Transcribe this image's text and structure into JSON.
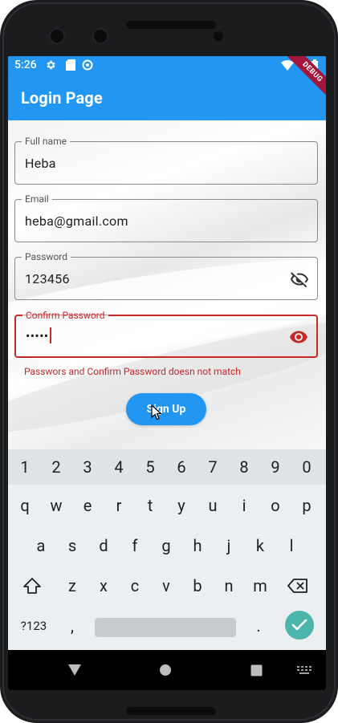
{
  "status_bar": {
    "time": "5:26"
  },
  "app_bar": {
    "title": "Login Page",
    "debug_banner": "DEBUG"
  },
  "form": {
    "full_name": {
      "label": "Full name",
      "value": "Heba"
    },
    "email": {
      "label": "Email",
      "value": "heba@gmail.com"
    },
    "password": {
      "label": "Password",
      "value": "123456",
      "icon": "visibility-off-icon"
    },
    "confirm_password": {
      "label": "Confirm Password",
      "value": "•••••",
      "icon": "visibility-icon"
    },
    "error_message": "Passwors and Confirm Password doesn not match",
    "signup_label": "Sign Up"
  },
  "keyboard": {
    "number_row": [
      "1",
      "2",
      "3",
      "4",
      "5",
      "6",
      "7",
      "8",
      "9",
      "0"
    ],
    "row1": [
      "q",
      "w",
      "e",
      "r",
      "t",
      "y",
      "u",
      "i",
      "o",
      "p"
    ],
    "row2": [
      "a",
      "s",
      "d",
      "f",
      "g",
      "h",
      "j",
      "k",
      "l"
    ],
    "row3": [
      "z",
      "x",
      "c",
      "v",
      "b",
      "n",
      "m"
    ],
    "symbols_label": "?123",
    "comma": ",",
    "period": "."
  },
  "colors": {
    "primary": "#2196f3",
    "error": "#c62828",
    "debug_ribbon": "#a2173b",
    "enter_key": "#4db6ac"
  }
}
